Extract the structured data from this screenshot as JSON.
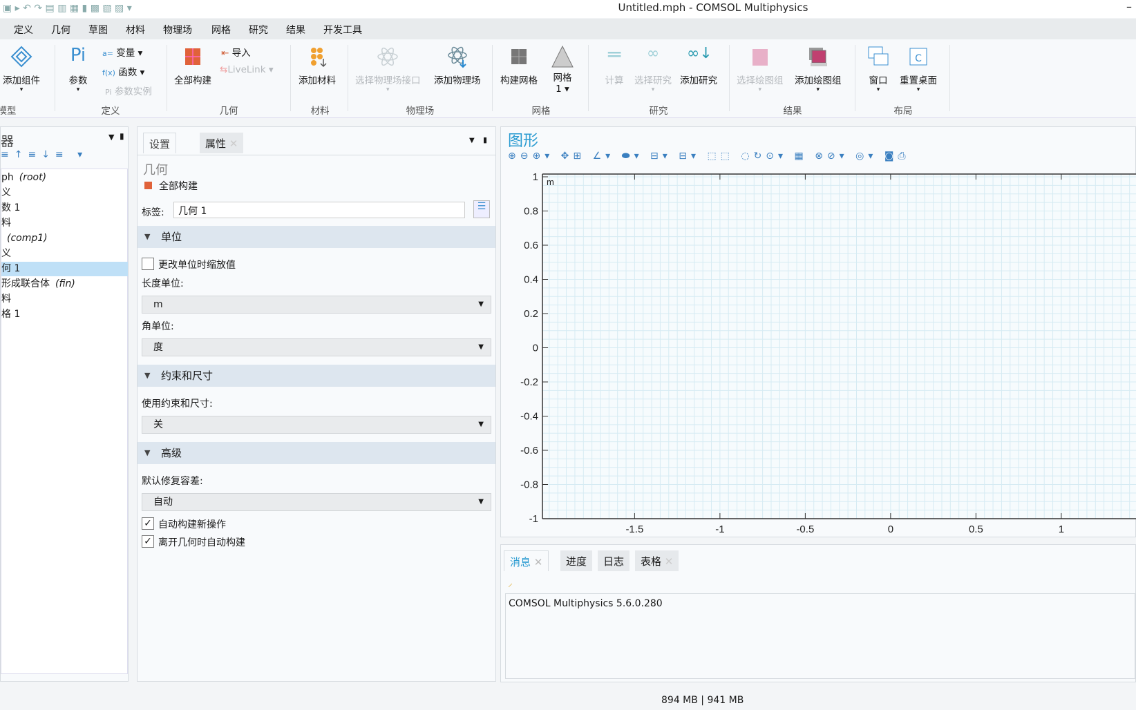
{
  "window": {
    "title": "Untitled.mph - COMSOL Multiphysics",
    "minimize": "–"
  },
  "menu": [
    "定义",
    "几何",
    "草图",
    "材料",
    "物理场",
    "网格",
    "研究",
    "结果",
    "开发工具"
  ],
  "ribbon": {
    "add_component": "添加组件",
    "parameters": "参数",
    "variables": "变量",
    "functions": "函数",
    "param_cases": "参数实例",
    "build_all": "全部构建",
    "import": "导入",
    "livelink": "LiveLink",
    "add_material": "添加材料",
    "select_physics": "选择物理场接口",
    "add_physics": "添加物理场",
    "build_mesh": "构建网格",
    "mesh1": "网格 1",
    "compute": "计算",
    "select_study": "选择研究",
    "add_study": "添加研究",
    "select_plot": "选择绘图组",
    "add_plot": "添加绘图组",
    "windows": "窗口",
    "reset_desktop": "重置桌面",
    "groups": [
      "模型",
      "定义",
      "几何",
      "材料",
      "物理场",
      "网格",
      "研究",
      "结果",
      "布局"
    ]
  },
  "model_builder": {
    "title": "器",
    "items": [
      {
        "text": "ph",
        "suffix": "(root)"
      },
      {
        "text": "义"
      },
      {
        "text": "数 1"
      },
      {
        "text": "料"
      },
      {
        "text": "",
        "suffix": "(comp1)"
      },
      {
        "text": "义"
      },
      {
        "text": "何 1",
        "selected": true
      },
      {
        "text": "形成联合体",
        "suffix": "(fin)"
      },
      {
        "text": "料"
      },
      {
        "text": "格 1"
      }
    ]
  },
  "settings": {
    "tabs": [
      "设置",
      "属性"
    ],
    "node_type": "几何",
    "build_all": "全部构建",
    "label_caption": "标签:",
    "label_value": "几何 1",
    "sections": {
      "units": "单位",
      "constraints": "约束和尺寸",
      "advanced": "高级"
    },
    "scale_values": "更改单位时缩放值",
    "scale_values_checked": false,
    "length_unit_label": "长度单位:",
    "length_unit": "m",
    "angle_unit_label": "角单位:",
    "angle_unit": "度",
    "use_constraints_label": "使用约束和尺寸:",
    "use_constraints": "关",
    "repair_tol_label": "默认修复容差:",
    "repair_tol": "自动",
    "auto_build_new": "自动构建新操作",
    "auto_build_new_checked": true,
    "auto_build_leave": "离开几何时自动构建",
    "auto_build_leave_checked": true
  },
  "graphics": {
    "title": "图形",
    "unit": "m",
    "x_ticks": [
      "-1.5",
      "-1",
      "-0.5",
      "0",
      "0.5",
      "1"
    ],
    "y_ticks": [
      "1",
      "0.8",
      "0.6",
      "0.4",
      "0.2",
      "0",
      "-0.2",
      "-0.4",
      "-0.6",
      "-0.8",
      "-1"
    ],
    "grid_color": "#d6ebf3"
  },
  "messages": {
    "tabs": [
      "消息",
      "进度",
      "日志",
      "表格"
    ],
    "text": "COMSOL Multiphysics 5.6.0.280"
  },
  "status": {
    "memory": "894 MB | 941 MB"
  }
}
